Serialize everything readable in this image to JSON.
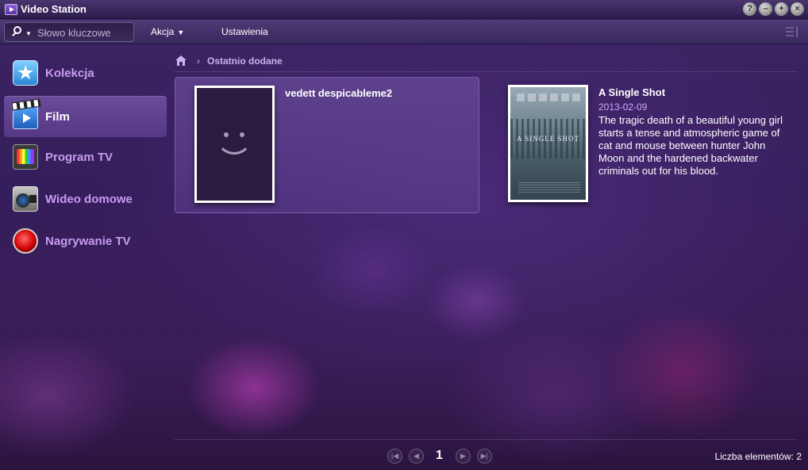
{
  "window": {
    "title": "Video Station"
  },
  "window_controls": [
    "?",
    "–",
    "+",
    "×"
  ],
  "toolbar": {
    "search_placeholder": "Słowo kluczowe",
    "action_label": "Akcja",
    "settings_label": "Ustawienia"
  },
  "sidebar": {
    "items": [
      {
        "label": "Kolekcja",
        "icon": "collection-star-icon",
        "active": false
      },
      {
        "label": "Film",
        "icon": "film-clapper-icon",
        "active": true
      },
      {
        "label": "Program TV",
        "icon": "tv-icon",
        "active": false
      },
      {
        "label": "Wideo domowe",
        "icon": "camcorder-icon",
        "active": false
      },
      {
        "label": "Nagrywanie TV",
        "icon": "record-icon",
        "active": false
      }
    ]
  },
  "breadcrumb": {
    "separator": "›",
    "current": "Ostatnio dodane"
  },
  "videos": [
    {
      "title": "vedett despicableme2",
      "date": "",
      "description": "",
      "poster": "placeholder-smiley",
      "selected": true
    },
    {
      "title": "A Single Shot",
      "date": "2013-02-09",
      "description": "The tragic death of a beautiful young girl starts a tense and atmospheric game of cat and mouse between hunter John Moon and the hardened backwater criminals out for his blood.",
      "poster": "movie-poster",
      "poster_text": "A SINGLE SHOT",
      "selected": false
    }
  ],
  "pagination": {
    "current_page": "1"
  },
  "footer": {
    "item_count": "Liczba elementów: 2"
  },
  "colors": {
    "accent_label": "#c79cf0",
    "date": "#d0a8f5",
    "background": "#3d2566"
  }
}
